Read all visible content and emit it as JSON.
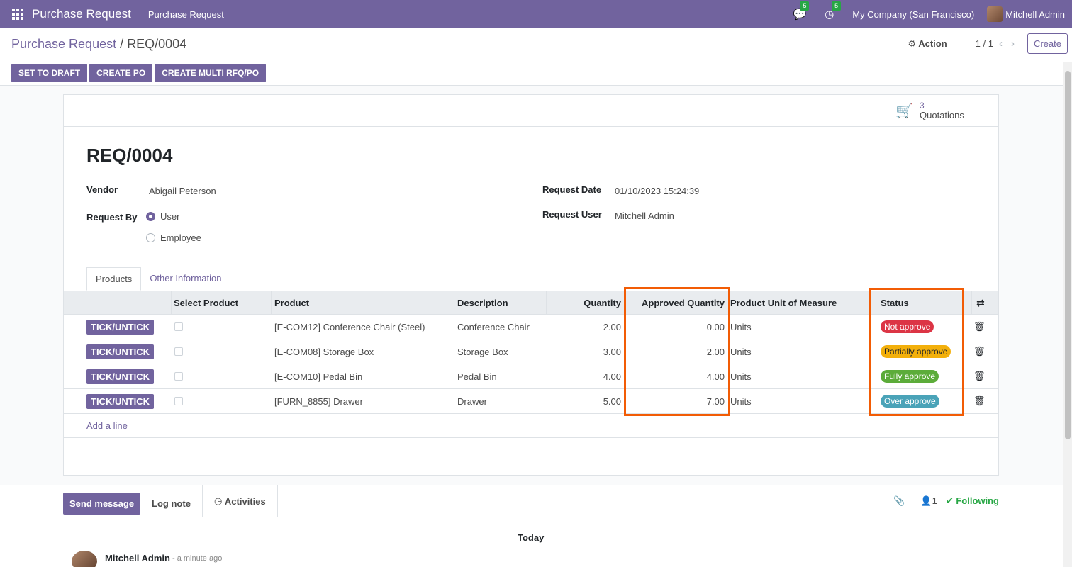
{
  "navbar": {
    "app_name": "Purchase Request",
    "menu": "Purchase Request",
    "messages_count": "5",
    "activities_count": "5",
    "company": "My Company (San Francisco)",
    "user": "Mitchell Admin"
  },
  "control": {
    "breadcrumb_parent": "Purchase Request",
    "breadcrumb_sep": "/",
    "breadcrumb_current": "REQ/0004",
    "action": "Action",
    "pager": "1 / 1",
    "create": "Create"
  },
  "statusbar": {
    "set_to_draft": "SET TO DRAFT",
    "create_po": "CREATE PO",
    "create_multi": "CREATE MULTI RFQ/PO"
  },
  "smart_button": {
    "count": "3",
    "label": "Quotations"
  },
  "record": {
    "title": "REQ/0004",
    "vendor_label": "Vendor",
    "vendor": "Abigail Peterson",
    "request_by_label": "Request By",
    "option_user": "User",
    "option_employee": "Employee",
    "request_date_label": "Request Date",
    "request_date": "01/10/2023 15:24:39",
    "request_user_label": "Request User",
    "request_user": "Mitchell Admin"
  },
  "tabs": {
    "products": "Products",
    "other": "Other Information"
  },
  "table": {
    "headers": {
      "select_product": "Select Product",
      "product": "Product",
      "description": "Description",
      "quantity": "Quantity",
      "approved_quantity": "Approved Quantity",
      "uom": "Product Unit of Measure",
      "status": "Status"
    },
    "tick_label": "TICK/UNTICK",
    "rows": [
      {
        "product": "[E-COM12] Conference Chair (Steel)",
        "description": "Conference Chair",
        "quantity": "2.00",
        "approved": "0.00",
        "uom": "Units",
        "status": "Not approve",
        "status_color": "#dc3545"
      },
      {
        "product": "[E-COM08] Storage Box",
        "description": "Storage Box",
        "quantity": "3.00",
        "approved": "2.00",
        "uom": "Units",
        "status": "Partially approve",
        "status_color": "#f3b00b"
      },
      {
        "product": "[E-COM10] Pedal Bin",
        "description": "Pedal Bin",
        "quantity": "4.00",
        "approved": "4.00",
        "uom": "Units",
        "status": "Fully approve",
        "status_color": "#5cac3a"
      },
      {
        "product": "[FURN_8855] Drawer",
        "description": "Drawer",
        "quantity": "5.00",
        "approved": "7.00",
        "uom": "Units",
        "status": "Over approve",
        "status_color": "#4aa3b8"
      }
    ],
    "add_line": "Add a line"
  },
  "chatter": {
    "send_message": "Send message",
    "log_note": "Log note",
    "activities": "Activities",
    "followers_count": "1",
    "following": "Following",
    "today": "Today",
    "author": "Mitchell Admin",
    "time": "- a minute ago"
  },
  "colors": {
    "brand": "#71639e",
    "highlight": "#f25c05"
  }
}
